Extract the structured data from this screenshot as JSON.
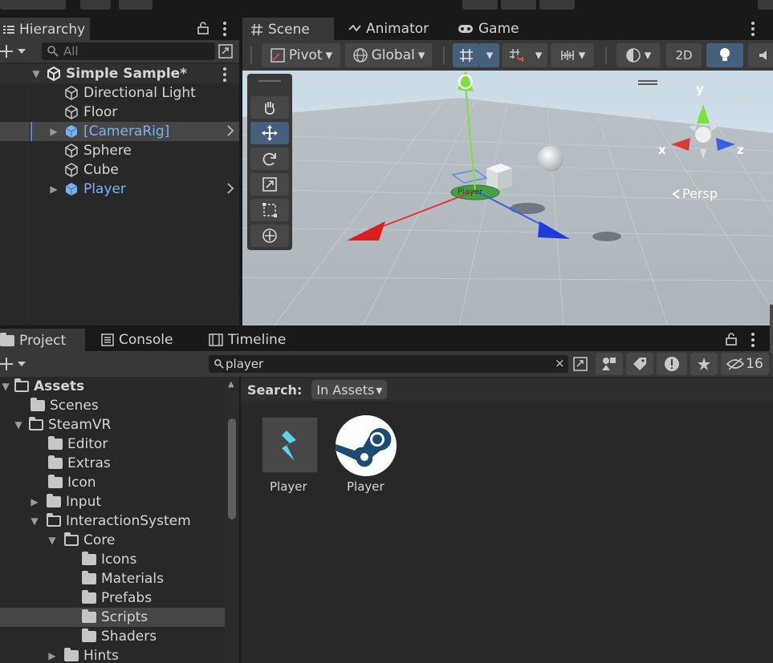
{
  "hierarchy": {
    "tab_label": "Hierarchy",
    "search_placeholder": "All",
    "scene_name": "Simple Sample*",
    "items": [
      {
        "label": "Directional Light"
      },
      {
        "label": "Floor"
      },
      {
        "label": "[CameraRig]"
      },
      {
        "label": "Sphere"
      },
      {
        "label": "Cube"
      },
      {
        "label": "Player"
      }
    ]
  },
  "scene": {
    "tabs": [
      {
        "label": "Scene"
      },
      {
        "label": "Animator"
      },
      {
        "label": "Game"
      }
    ],
    "toolbar": {
      "pivot": "Pivot",
      "global": "Global",
      "mode_2d": "2D"
    },
    "gizmo": {
      "persp": "Persp",
      "x": "x",
      "y": "y",
      "z": "z",
      "object_label": "Player"
    }
  },
  "project": {
    "tabs": [
      {
        "label": "Project"
      },
      {
        "label": "Console"
      },
      {
        "label": "Timeline"
      }
    ],
    "search_value": "player",
    "search_scope_label": "Search:",
    "search_scope_value": "In Assets",
    "visibility_count": "16",
    "tree": [
      {
        "label": "Assets"
      },
      {
        "label": "Scenes"
      },
      {
        "label": "SteamVR"
      },
      {
        "label": "Editor"
      },
      {
        "label": "Extras"
      },
      {
        "label": "Icon"
      },
      {
        "label": "Input"
      },
      {
        "label": "InteractionSystem"
      },
      {
        "label": "Core"
      },
      {
        "label": "Icons"
      },
      {
        "label": "Materials"
      },
      {
        "label": "Prefabs"
      },
      {
        "label": "Scripts"
      },
      {
        "label": "Shaders"
      },
      {
        "label": "Hints"
      }
    ],
    "results": [
      {
        "label": "Player",
        "icon": "script-icon"
      },
      {
        "label": "Player",
        "icon": "steam-icon"
      }
    ]
  },
  "colors": {
    "selection_blue": "#7bb1f2",
    "accent_button": "#46607c"
  }
}
